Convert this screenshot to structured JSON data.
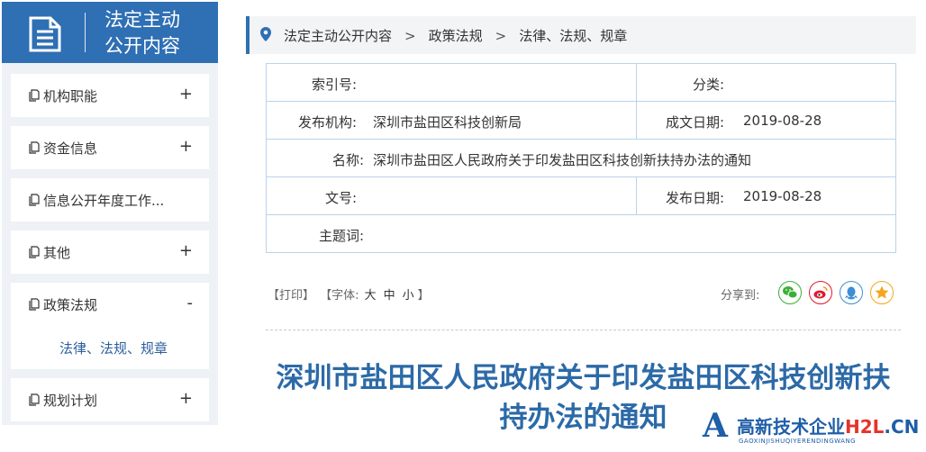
{
  "sidebar": {
    "header_line1": "法定主动",
    "header_line2": "公开内容",
    "items": [
      {
        "label": "机构职能",
        "toggle": "+"
      },
      {
        "label": "资金信息",
        "toggle": "+"
      },
      {
        "label": "信息公开年度工作..."
      },
      {
        "label": "其他",
        "toggle": "+"
      },
      {
        "label": "政策法规",
        "toggle": "-",
        "sub": "法律、法规、规章"
      },
      {
        "label": "规划计划",
        "toggle": "+"
      }
    ]
  },
  "breadcrumb": {
    "items": [
      "法定主动公开内容",
      "政策法规",
      "法律、法规、规章"
    ],
    "separator": ">"
  },
  "meta": {
    "index_label": "索引号:",
    "index_value": "",
    "category_label": "分类:",
    "category_value": "",
    "publisher_label": "发布机构:",
    "publisher_value": "深圳市盐田区科技创新局",
    "created_label": "成文日期:",
    "created_value": "2019-08-28",
    "name_label": "名称:",
    "name_value": "深圳市盐田区人民政府关于印发盐田区科技创新扶持办法的通知",
    "docno_label": "文号:",
    "docno_value": "",
    "published_label": "发布日期:",
    "published_value": "2019-08-28",
    "subject_label": "主题词:",
    "subject_value": ""
  },
  "tools": {
    "print": "【打印】",
    "font_prefix": "【字体:",
    "font_large": "大",
    "font_medium": "中",
    "font_small": "小",
    "font_suffix": "】",
    "share_label": "分享到:",
    "share_icons": [
      "wechat-icon",
      "weibo-icon",
      "qq-icon",
      "qzone-icon"
    ]
  },
  "article": {
    "title_line1": "深圳市盐田区人民政府关于印发盐田区科技创新扶",
    "title_line2": "持办法的通知"
  },
  "watermark": {
    "logo_letter": "A",
    "main_text": "高新技术企业",
    "brand_red": "H2L",
    "domain_suffix": ".CN",
    "sub_text": "GAOXINJISHUQIYERENDINGWANG"
  },
  "colors": {
    "primary_blue": "#2f6fb3",
    "title_blue": "#2c6aa7",
    "table_border": "#b9d3ea",
    "sidebar_bg": "#eef1f5",
    "wechat_green": "#3cb034",
    "weibo_red": "#e6162d",
    "qq_blue": "#3d8fd6",
    "qzone_yellow": "#f3a620"
  }
}
